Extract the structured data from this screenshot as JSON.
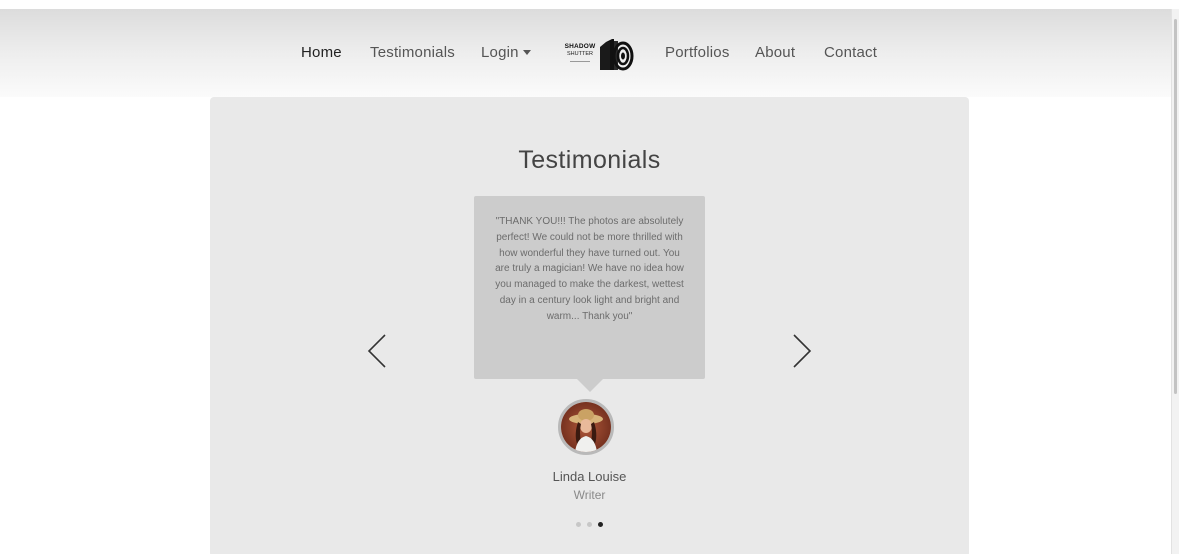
{
  "nav": {
    "home": "Home",
    "testimonials": "Testimonials",
    "login": "Login",
    "portfolios": "Portfolios",
    "about": "About",
    "contact": "Contact"
  },
  "logo": {
    "line1": "SHADOW",
    "line2": "SHUTTER",
    "icon": "camera-logo-icon"
  },
  "testimonials": {
    "title": "Testimonials",
    "quote": "\"THANK YOU!!! The photos are absolutely perfect! We could not be more thrilled with how wonderful they have turned out. You are truly a magician! We have no idea how you managed to make the darkest, wettest day in a century look light and bright and warm... Thank you\"",
    "name": "Linda Louise",
    "role": "Writer",
    "slide_count": 3,
    "active_slide": 3
  },
  "icons": {
    "prev": "chevron-left-icon",
    "next": "chevron-right-icon",
    "login_caret": "caret-down-icon"
  },
  "colors": {
    "panel": "#e9e9e9",
    "bubble": "#cccccc",
    "active_dot": "#222222"
  }
}
